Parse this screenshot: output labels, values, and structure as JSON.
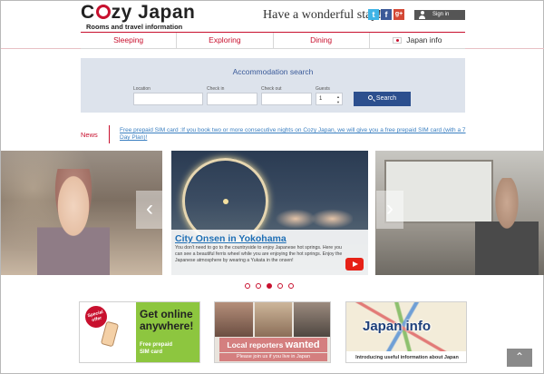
{
  "header": {
    "logo_text": "Cozy Japan",
    "logo_prefix": "C",
    "logo_suffix": "zy Japan",
    "logo_sub": "Rooms and travel information",
    "tagline": "Have a wonderful stay!",
    "social": [
      {
        "icon": "twitter-icon",
        "glyph": "t"
      },
      {
        "icon": "facebook-icon",
        "glyph": "f"
      },
      {
        "icon": "google-plus-icon",
        "glyph": "g+"
      }
    ],
    "signin_label": "Sign in"
  },
  "nav": {
    "items": [
      {
        "label": "Sleeping"
      },
      {
        "label": "Exploring"
      },
      {
        "label": "Dining"
      },
      {
        "label": "Japan info",
        "icon": "japan-flag-icon"
      }
    ]
  },
  "search": {
    "title": "Accommodation search",
    "location_label": "Location",
    "location_value": "",
    "checkin_label": "Check in",
    "checkin_value": "",
    "checkout_label": "Check out",
    "checkout_value": "",
    "guests_label": "Guests",
    "guests_value": "1",
    "button_label": "Search"
  },
  "news": {
    "label": "News",
    "text": "Free prepaid SIM card :If you book two or more consecutive nights on Cozy Japan, we will give you a free prepaid SIM card (with a 7 Day Plan)!"
  },
  "slider": {
    "caption_title": "City Onsen in Yokohama",
    "caption_body": "You don't need to go to the countryside to enjoy Japanese hot springs. Here you can see a beautiful ferris wheel while you are enjoying the hot springs. Enjoy the Japanese atmosphere by wearing a Yukata in the onsen!",
    "prev_glyph": "‹",
    "next_glyph": "›",
    "dots_total": 5,
    "active_dot": 3
  },
  "banners": {
    "sim": {
      "badge": "Special offer",
      "headline_1": "Get online",
      "headline_2": "anywhere!",
      "sub_1": "Free prepaid",
      "sub_2": "SIM card"
    },
    "reporters": {
      "title_small": "Local reporters ",
      "title_big": "wanted",
      "line": "Please join us if you live in Japan"
    },
    "japan_info": {
      "title": "Japan info",
      "foot": "Introducing useful information about Japan"
    }
  },
  "back_to_top": {
    "glyph": "⌃",
    "icon": "back-to-top-icon"
  },
  "colors": {
    "accent": "#c8102e",
    "link": "#1f6fb5",
    "search_panel": "#dde3ec",
    "button": "#2c4f8e"
  }
}
